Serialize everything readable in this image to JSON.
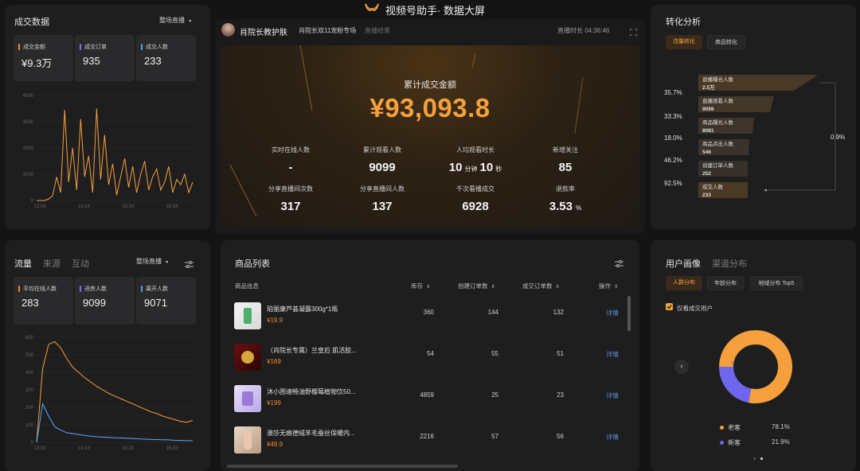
{
  "header": {
    "title": "视频号助手· 数据大屏"
  },
  "sales_panel": {
    "title": "成交数据",
    "scope": "整场直播",
    "kpis": [
      {
        "label": "成交金额",
        "value": "¥9.3万",
        "sub": "-",
        "color": "#f08a2a"
      },
      {
        "label": "成交订单",
        "value": "935",
        "sub": "-",
        "color": "#8a6cf0"
      },
      {
        "label": "成交人数",
        "value": "233",
        "sub": "-",
        "color": "#4aa8e0"
      }
    ],
    "chart_y": [
      "4000",
      "3000",
      "2000",
      "1000",
      "0"
    ],
    "chart_x": [
      "13:04",
      "14:14",
      "15:24",
      "16:34"
    ]
  },
  "live": {
    "host_name": "肖院长教护肤",
    "stream_title": "肖院长双11宠粉专场",
    "status": "直播结束",
    "duration": "直播时长 04:36:46"
  },
  "hero": {
    "label": "累计成交金额",
    "value": "¥93,093.8",
    "stats": [
      {
        "label": "实时在线人数",
        "value": "-"
      },
      {
        "label": "累计观看人数",
        "value": "9099"
      },
      {
        "label": "人均观看时长",
        "v1": "10",
        "u1": "分钟",
        "v2": "10",
        "u2": "秒"
      },
      {
        "label": "新增关注",
        "value": "85"
      },
      {
        "label": "分享直播间次数",
        "value": "317"
      },
      {
        "label": "分享直播间人数",
        "value": "137"
      },
      {
        "label": "千次看播成交",
        "value": "6928"
      },
      {
        "label": "退款率",
        "value": "3.53",
        "unit": "%"
      }
    ]
  },
  "conversion": {
    "title": "转化分析",
    "tabs": [
      "流量转化",
      "商品转化"
    ],
    "steps": [
      {
        "label": "直播曝光人数",
        "value": "2.5万"
      },
      {
        "label": "直播观看人数",
        "value": "9099"
      },
      {
        "label": "商品曝光人数",
        "value": "8081"
      },
      {
        "label": "商品点击人数",
        "value": "546"
      },
      {
        "label": "创建订单人数",
        "value": "252"
      },
      {
        "label": "成交人数",
        "value": "233"
      }
    ],
    "rates": [
      "35.7%",
      "33.3%",
      "18.0%",
      "46.2%",
      "92.5%"
    ],
    "overall": "0.9%"
  },
  "traffic": {
    "tabs": [
      "流量",
      "来源",
      "互动"
    ],
    "scope": "整场直播",
    "kpis": [
      {
        "label": "平均在线人数",
        "value": "283",
        "sub": "-",
        "color": "#f08a2a"
      },
      {
        "label": "进房人数",
        "value": "9099",
        "sub": "-",
        "color": "#8a6cf0"
      },
      {
        "label": "离开人数",
        "value": "9071",
        "sub": "-",
        "color": "#4aa8e0"
      }
    ],
    "chart_y": [
      "600",
      "500",
      "400",
      "300",
      "200",
      "100",
      "0"
    ],
    "chart_x": [
      "13:03",
      "14:13",
      "15:23",
      "16:33"
    ]
  },
  "products": {
    "title": "商品列表",
    "columns": [
      "商品信息",
      "库存",
      "创建订单数",
      "成交订单数",
      "操作"
    ],
    "rows": [
      {
        "name": "珀丽康芦荟凝露300g*1瓶",
        "price": "¥19.9",
        "stock": "360",
        "created": "144",
        "deals": "132",
        "action": "详情"
      },
      {
        "name": "（肖院长专属）兰皇后 肌活胶...",
        "price": "¥169",
        "stock": "54",
        "created": "55",
        "deals": "51",
        "action": "详情"
      },
      {
        "name": "沐小困速畅油野樱莓植物饮50...",
        "price": "¥199",
        "stock": "4859",
        "created": "25",
        "deals": "23",
        "action": "详情"
      },
      {
        "name": "澳莎无痕德绒羊毛蚕丝保暖内...",
        "price": "¥49.9",
        "stock": "2216",
        "created": "57",
        "deals": "56",
        "action": "详情"
      }
    ]
  },
  "users": {
    "tabs": [
      "用户画像",
      "渠道分布"
    ],
    "filters": [
      "人群分布",
      "年龄分布",
      "地域分布 Top5"
    ],
    "checkbox_label": "仅看成交用户",
    "legend": [
      {
        "name": "老客",
        "value": "78.1%",
        "color": "#f5a03c"
      },
      {
        "name": "新客",
        "value": "21.9%",
        "color": "#6f66ee"
      }
    ]
  },
  "chart_data": [
    {
      "type": "line",
      "title": "",
      "x": [
        "13:04",
        "14:14",
        "15:24",
        "16:34"
      ],
      "ylim": [
        0,
        4000
      ],
      "series": [
        {
          "name": "",
          "values": [
            0,
            0,
            0,
            60,
            180,
            900,
            300,
            3450,
            700,
            2000,
            400,
            3100,
            900,
            1700,
            300,
            3500,
            800,
            2500,
            600,
            1400,
            200,
            900,
            1600,
            500,
            1300,
            300,
            1000,
            1500,
            400,
            900,
            1200,
            400,
            700,
            1300,
            300,
            800,
            600,
            1000,
            300,
            700
          ]
        }
      ]
    },
    {
      "type": "line",
      "title": "",
      "x": [
        "13:03",
        "14:13",
        "15:23",
        "16:33"
      ],
      "ylim": [
        0,
        600
      ],
      "series": [
        {
          "name": "",
          "values": [
            0,
            420,
            560,
            575,
            540,
            480,
            430,
            400,
            370,
            345,
            320,
            300,
            280,
            265,
            250,
            235,
            220,
            205,
            190,
            175,
            165,
            150,
            140,
            130,
            120,
            115,
            125
          ]
        },
        {
          "name": "",
          "values": [
            0,
            220,
            150,
            90,
            70,
            55,
            50,
            45,
            40,
            35,
            32,
            30,
            28,
            26,
            25,
            24,
            22,
            20,
            18,
            17,
            16,
            15,
            14,
            12,
            11,
            10,
            9
          ]
        }
      ]
    },
    {
      "type": "pie",
      "title": "",
      "categories": [
        "老客",
        "新客"
      ],
      "values": [
        78.1,
        21.9
      ]
    }
  ]
}
